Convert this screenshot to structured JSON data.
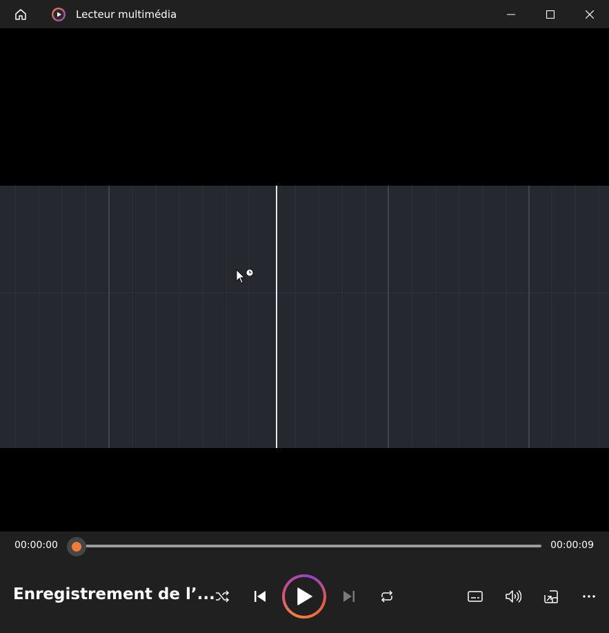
{
  "window": {
    "title": "Lecteur multimédia",
    "controls": [
      "minimize",
      "maximize",
      "close"
    ]
  },
  "icons": {
    "home": "home-icon",
    "app": "media-player-icon",
    "shuffle": "shuffle-icon",
    "previous": "skip-previous-icon",
    "play": "play-icon",
    "next": "skip-next-icon",
    "repeat": "repeat-icon",
    "subtitles": "subtitles-icon",
    "volume": "volume-icon",
    "miniplayer": "mini-player-icon",
    "more": "more-icon"
  },
  "player": {
    "current_time": "00:00:00",
    "duration": "00:00:09",
    "progress": 0.0,
    "media_title": "Enregistrement de l’..."
  },
  "colors": {
    "accent": "#f07a3a",
    "titlebar": "#202020",
    "video_frame": "#25282e"
  }
}
